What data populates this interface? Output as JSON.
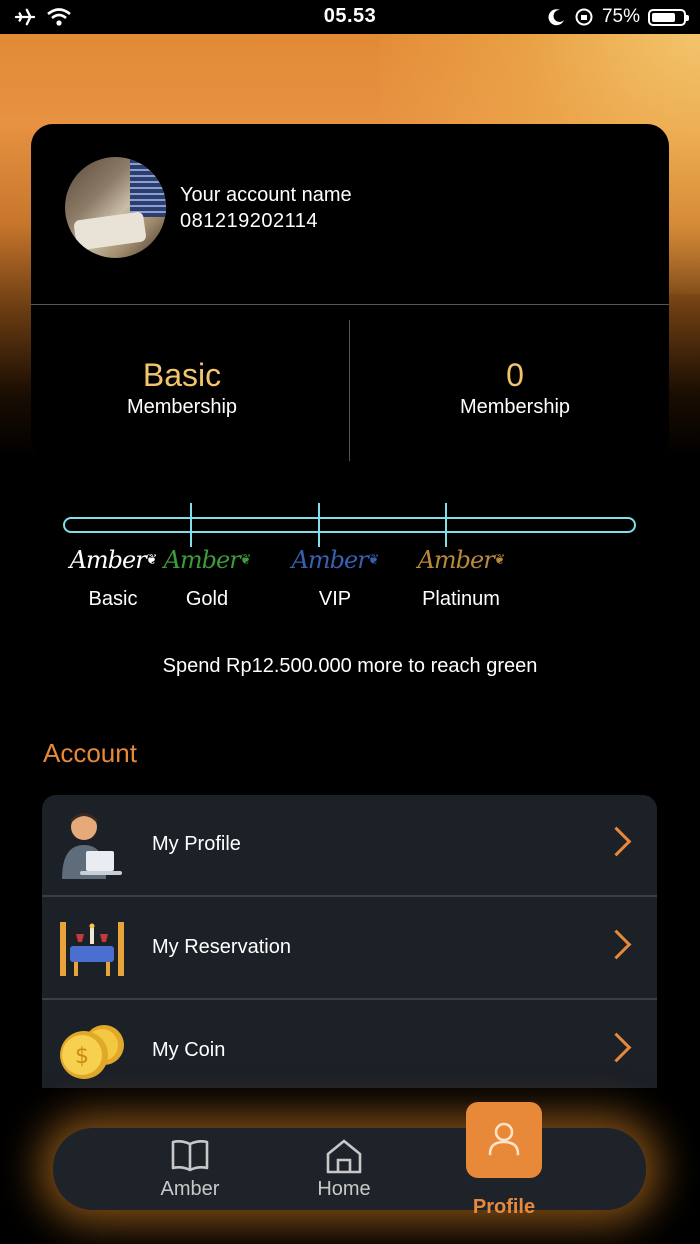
{
  "status_bar": {
    "time": "05.53",
    "battery_text": "75%",
    "battery_level": 0.75,
    "left_icons": [
      "airplane-icon",
      "wifi-icon"
    ],
    "right_icons": [
      "moon-icon",
      "orientation-lock-icon",
      "battery-icon"
    ]
  },
  "account": {
    "name": "Your account name",
    "phone": "081219202114",
    "membership_tier": "Basic",
    "membership_tier_label": "Membership",
    "membership_points": "0",
    "membership_points_label": "Membership"
  },
  "tiers": [
    {
      "logo": "Amber",
      "label": "Basic",
      "color": "#ffffff"
    },
    {
      "logo": "Amber",
      "label": "Gold",
      "color": "#3e9a3c"
    },
    {
      "logo": "Amber",
      "label": "VIP",
      "color": "#3a5fb0"
    },
    {
      "logo": "Amber",
      "label": "Platinum",
      "color": "#b8893a"
    }
  ],
  "progress_value": 0,
  "spend_message": "Spend Rp12.500.000 more to reach green",
  "section_title": "Account",
  "menu": [
    {
      "label": "My Profile",
      "icon": "person-laptop-icon"
    },
    {
      "label": "My Reservation",
      "icon": "dining-table-icon"
    },
    {
      "label": "My Coin",
      "icon": "coins-icon"
    }
  ],
  "nav": {
    "items": [
      {
        "label": "Amber",
        "icon": "book-icon"
      },
      {
        "label": "Home",
        "icon": "home-icon"
      },
      {
        "label": "Profile",
        "icon": "user-icon"
      }
    ],
    "active": "Profile"
  },
  "colors": {
    "accent": "#e8893a",
    "gold_text": "#f2c56c",
    "progress": "#7fe0ea",
    "card": "#1c2027"
  }
}
